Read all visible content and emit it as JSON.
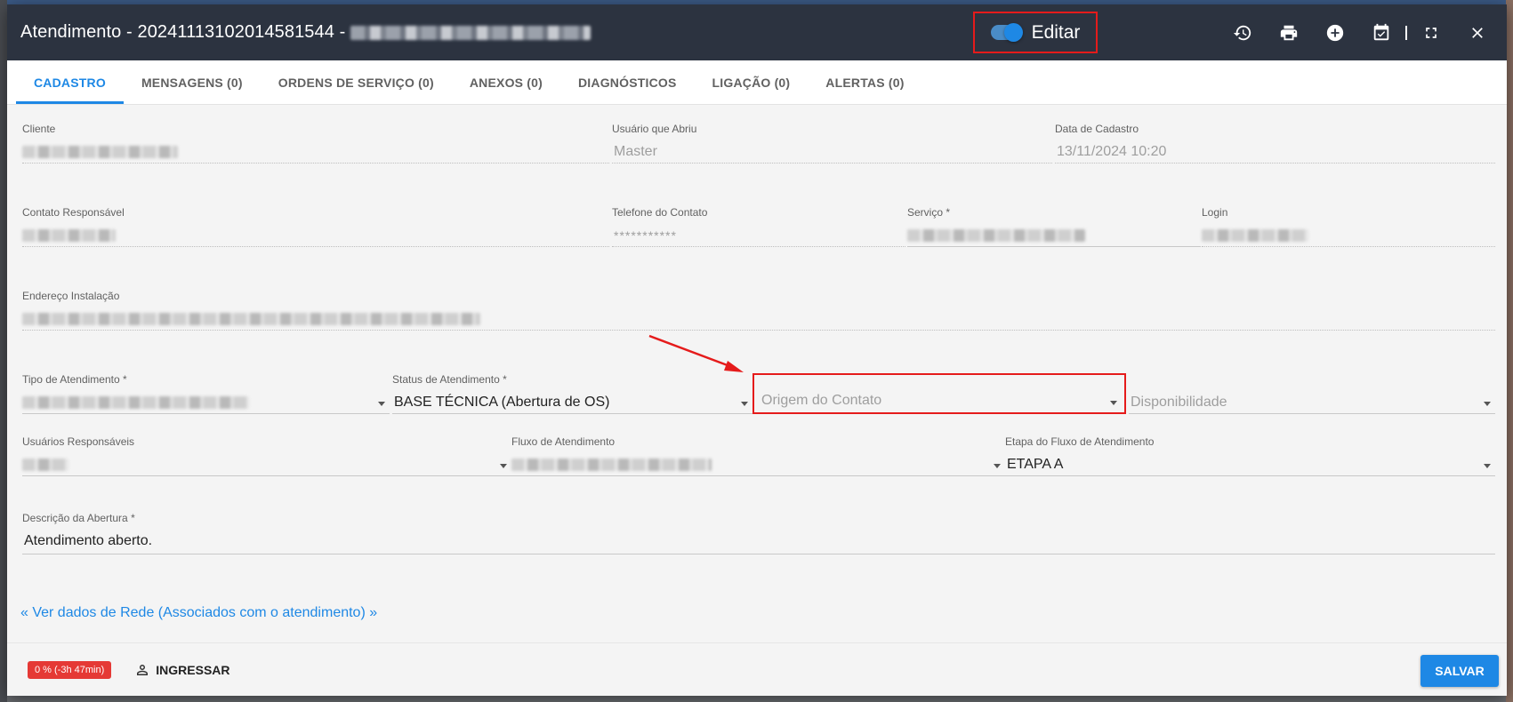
{
  "window": {
    "title": "Atendimento - 20241113102014581544 -",
    "edit_label": "Editar"
  },
  "toolbar_icons": [
    "history-icon",
    "print-icon",
    "add-circle-icon",
    "calendar-check-icon",
    "fullscreen-icon",
    "close-icon"
  ],
  "tabs": [
    {
      "label": "CADASTRO",
      "active": true
    },
    {
      "label": "MENSAGENS (0)"
    },
    {
      "label": "ORDENS DE SERVIÇO (0)"
    },
    {
      "label": "ANEXOS (0)"
    },
    {
      "label": "DIAGNÓSTICOS"
    },
    {
      "label": "LIGAÇÃO (0)"
    },
    {
      "label": "ALERTAS (0)"
    }
  ],
  "form": {
    "cliente": {
      "label": "Cliente"
    },
    "usuario_abriu": {
      "label": "Usuário que Abriu",
      "value": "Master"
    },
    "data_cadastro": {
      "label": "Data de Cadastro",
      "value": "13/11/2024 10:20"
    },
    "contato_responsavel": {
      "label": "Contato Responsável"
    },
    "telefone_contato": {
      "label": "Telefone do Contato",
      "value": "***********"
    },
    "servico": {
      "label": "Serviço *"
    },
    "login": {
      "label": "Login"
    },
    "endereco_instalacao": {
      "label": "Endereço Instalação"
    },
    "tipo_atendimento": {
      "label": "Tipo de Atendimento *"
    },
    "status_atendimento": {
      "label": "Status de Atendimento *",
      "value": "BASE TÉCNICA (Abertura de OS)"
    },
    "origem_contato": {
      "placeholder": "Origem do Contato"
    },
    "disponibilidade": {
      "placeholder": "Disponibilidade"
    },
    "usuarios_responsaveis": {
      "label": "Usuários Responsáveis"
    },
    "fluxo_atendimento": {
      "label": "Fluxo de Atendimento"
    },
    "etapa_fluxo": {
      "label": "Etapa do Fluxo de Atendimento",
      "value": "ETAPA A"
    },
    "descricao_abertura": {
      "label": "Descrição da Abertura *",
      "value": "Atendimento aberto."
    }
  },
  "network_link": "« Ver dados de Rede (Associados com o atendimento) »",
  "footer": {
    "sla_badge": "0 % (-3h 47min)",
    "join_label": "INGRESSAR",
    "save_label": "SALVAR"
  },
  "colors": {
    "accent": "#1e88e5",
    "title_bar": "#2c3340",
    "highlight": "#e51b1b",
    "sla": "#e53935"
  }
}
